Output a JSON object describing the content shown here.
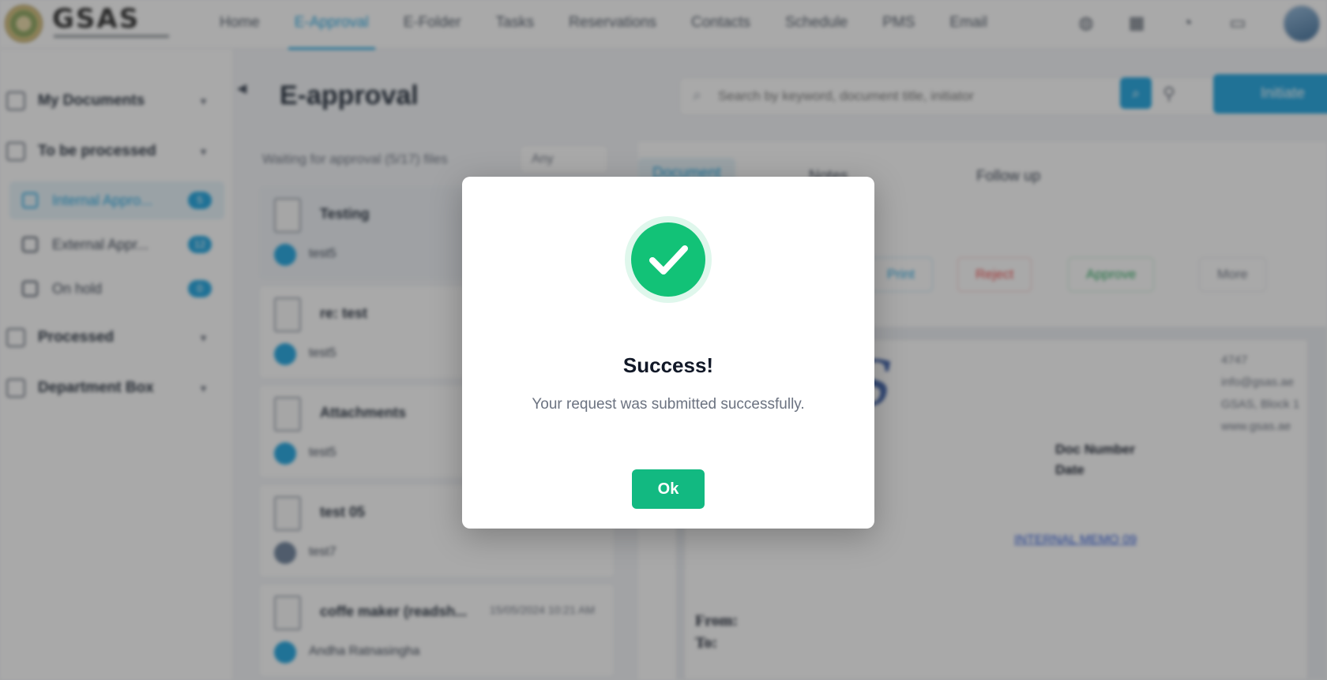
{
  "header": {
    "logo_text": "GSAS",
    "nav_items": [
      "Home",
      "E-Approval",
      "E-Folder",
      "Tasks",
      "Reservations",
      "Contacts",
      "Schedule",
      "PMS",
      "Email"
    ],
    "active_nav": "E-Approval",
    "icons": [
      "globe-icon",
      "apps-icon",
      "bell-icon",
      "chat-icon"
    ]
  },
  "sidebar": {
    "groups": [
      {
        "label": "My Documents"
      },
      {
        "label": "To be processed"
      },
      {
        "label": "Processed"
      },
      {
        "label": "Department Box"
      }
    ],
    "subitems": [
      {
        "label": "Internal Appro...",
        "badge": "5"
      },
      {
        "label": "External Appr...",
        "badge": "12"
      },
      {
        "label": "On hold",
        "badge": "0"
      }
    ]
  },
  "main": {
    "title": "E-approval",
    "search_placeholder": "Search by keyword, document title, initiator",
    "initiate_label": "Initiate",
    "list_caption": "Waiting for approval (5/17) files",
    "list_filter": "Any",
    "items": [
      {
        "title": "Testing",
        "user": "test5",
        "date": ""
      },
      {
        "title": "re: test",
        "user": "test5",
        "date": ""
      },
      {
        "title": "Attachments",
        "user": "test5",
        "date": ""
      },
      {
        "title": "test 05",
        "user": "test7",
        "date": ""
      },
      {
        "title": "coffe maker (readsh...",
        "user": "Andha Ratnasingha",
        "date": "15/05/2024 10:21 AM"
      }
    ]
  },
  "detail": {
    "tabs": [
      "Document",
      "Notes",
      "Follow up"
    ],
    "actions": [
      "Print",
      "Reject",
      "Approve",
      "More"
    ],
    "doc": {
      "contact_lines": [
        "4747",
        "info@gsas.ae",
        "GSAS, Block 1",
        "www.gsas.ae"
      ],
      "doc_number_label": "Doc Number",
      "date_label": "Date",
      "link_text": "INTERNAL MEMO 09",
      "from_label": "From:",
      "to_label": "To:"
    }
  },
  "modal": {
    "title": "Success!",
    "message": "Your request was submitted successfully.",
    "ok_label": "Ok",
    "icon": "check-circle-icon",
    "accent_color": "#12b981"
  }
}
